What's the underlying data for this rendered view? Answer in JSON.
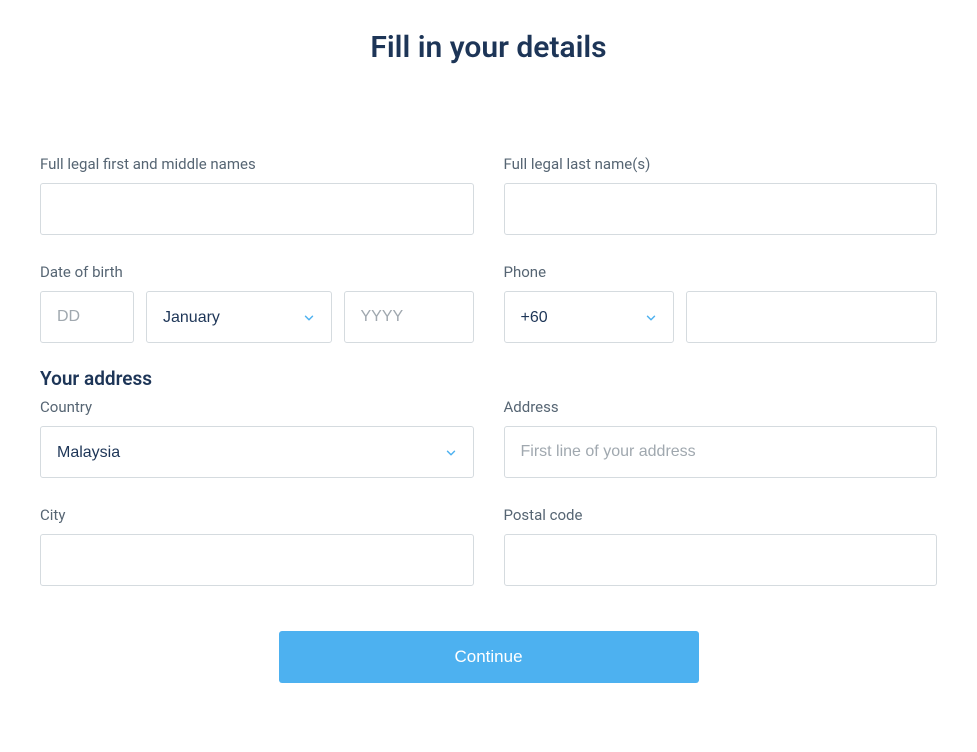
{
  "title": "Fill in your details",
  "fields": {
    "first_middle": {
      "label": "Full legal first and middle names",
      "value": "",
      "placeholder": ""
    },
    "last_name": {
      "label": "Full legal last name(s)",
      "value": "",
      "placeholder": ""
    },
    "dob": {
      "label": "Date of birth",
      "day": {
        "value": "",
        "placeholder": "DD"
      },
      "month": {
        "value": "January"
      },
      "year": {
        "value": "",
        "placeholder": "YYYY"
      }
    },
    "phone": {
      "label": "Phone",
      "code": {
        "value": "+60"
      },
      "number": {
        "value": "",
        "placeholder": ""
      }
    },
    "address_section": {
      "heading": "Your address"
    },
    "country": {
      "label": "Country",
      "value": "Malaysia"
    },
    "address": {
      "label": "Address",
      "value": "",
      "placeholder": "First line of your address"
    },
    "city": {
      "label": "City",
      "value": "",
      "placeholder": ""
    },
    "postal_code": {
      "label": "Postal code",
      "value": "",
      "placeholder": ""
    }
  },
  "buttons": {
    "continue": "Continue"
  },
  "colors": {
    "primary": "#4db1f0",
    "heading": "#1d3557",
    "label": "#566573",
    "border": "#d5dbdf",
    "placeholder": "#a0a8af"
  }
}
